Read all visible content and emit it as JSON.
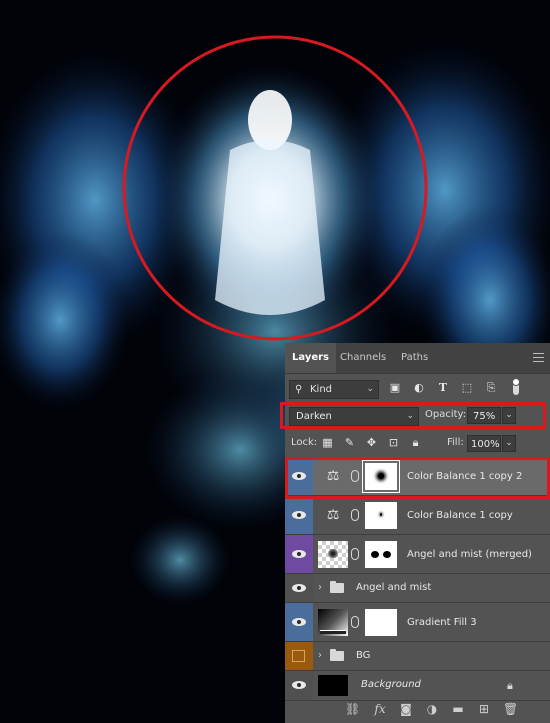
{
  "panel": {
    "tabs": [
      "Layers",
      "Channels",
      "Paths"
    ],
    "filter": {
      "kind_label": "Kind"
    },
    "blend_mode": "Darken",
    "opacity_label": "Opacity:",
    "opacity_value": "75%",
    "lock_label": "Lock:",
    "fill_label": "Fill:",
    "fill_value": "100%",
    "layers": [
      {
        "name": "Color Balance 1 copy 2",
        "selected": true,
        "visible": true
      },
      {
        "name": "Color Balance 1 copy",
        "visible": true
      },
      {
        "name": "Angel and mist (merged)",
        "visible": true
      },
      {
        "name": "Angel and mist",
        "type": "group",
        "visible": true
      },
      {
        "name": "Gradient Fill 3",
        "visible": true
      },
      {
        "name": "BG",
        "type": "group",
        "visible": false
      },
      {
        "name": "Background",
        "locked": true,
        "visible": true
      }
    ]
  },
  "colors": {
    "highlight": "#d71920",
    "panel_bg": "#535353",
    "vis_blue": "#4a6d9b",
    "vis_purple": "#6f4aa0",
    "vis_orange": "#9a5a0e"
  },
  "icons": [
    "search-icon",
    "image-filter-icon",
    "adjustment-filter-icon",
    "type-filter-icon",
    "shape-filter-icon",
    "smart-object-filter-icon",
    "filter-toggle",
    "panel-menu-icon",
    "lock-transparent-icon",
    "lock-paint-icon",
    "lock-move-icon",
    "lock-artboard-icon",
    "lock-all-icon",
    "eye-icon",
    "scales-icon",
    "chain-icon",
    "folder-icon",
    "lock-icon",
    "link-layers-icon",
    "fx-icon",
    "add-mask-icon",
    "new-adjustment-icon",
    "new-group-icon",
    "new-layer-icon",
    "delete-icon"
  ]
}
